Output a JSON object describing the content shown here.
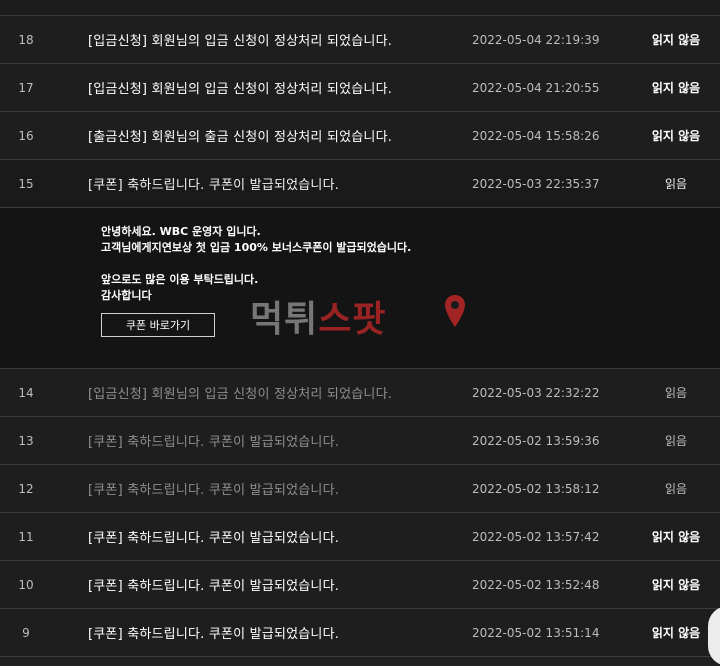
{
  "notifications": [
    {
      "num": "18",
      "title": "[입금신청] 회원님의 입금 신청이 정상처리 되었습니다.",
      "date": "2022-05-04 22:19:39",
      "status": "읽지 않음"
    },
    {
      "num": "17",
      "title": "[입금신청] 회원님의 입금 신청이 정상처리 되었습니다.",
      "date": "2022-05-04 21:20:55",
      "status": "읽지 않음"
    },
    {
      "num": "16",
      "title": "[출금신청] 회원님의 출금 신청이 정상처리 되었습니다.",
      "date": "2022-05-04 15:58:26",
      "status": "읽지 않음"
    },
    {
      "num": "15",
      "title": "[쿠폰] 축하드립니다. 쿠폰이 발급되었습니다.",
      "date": "2022-05-03 22:35:37",
      "status": "읽음"
    },
    {
      "num": "14",
      "title": "[입금신청] 회원님의 입금 신청이 정상처리 되었습니다.",
      "date": "2022-05-03 22:32:22",
      "status": "읽음"
    },
    {
      "num": "13",
      "title": "[쿠폰] 축하드립니다. 쿠폰이 발급되었습니다.",
      "date": "2022-05-02 13:59:36",
      "status": "읽음"
    },
    {
      "num": "12",
      "title": "[쿠폰] 축하드립니다. 쿠폰이 발급되었습니다.",
      "date": "2022-05-02 13:58:12",
      "status": "읽음"
    },
    {
      "num": "11",
      "title": "[쿠폰] 축하드립니다. 쿠폰이 발급되었습니다.",
      "date": "2022-05-02 13:57:42",
      "status": "읽지 않음"
    },
    {
      "num": "10",
      "title": "[쿠폰] 축하드립니다. 쿠폰이 발급되었습니다.",
      "date": "2022-05-02 13:52:48",
      "status": "읽지 않음"
    },
    {
      "num": "9",
      "title": "[쿠폰] 축하드립니다. 쿠폰이 발급되었습니다.",
      "date": "2022-05-02 13:51:14",
      "status": "읽지 않음"
    }
  ],
  "detail": {
    "lines": [
      "안녕하세요. WBC 운영자 입니다.",
      "고객님에게지연보상 첫 입금 100% 보너스쿠폰이 발급되었습니다.",
      "",
      "앞으로도 많은 이용 부탁드립니다.",
      "감사합니다"
    ],
    "button_label": "쿠폰 바로가기"
  },
  "watermark": {
    "part1": "먹튀",
    "part2": "스팟",
    "pin_icon": "location-pin-icon"
  },
  "colors": {
    "background": "#1f1f1f",
    "unread_text": "#ffffff",
    "read_text": "#8e8e8e",
    "watermark_accent": "#c62828"
  }
}
